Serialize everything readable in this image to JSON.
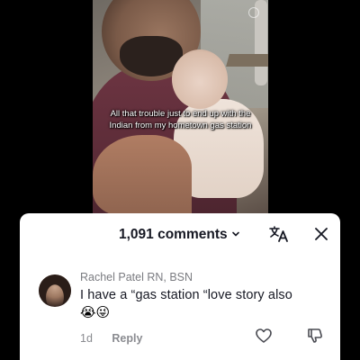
{
  "video": {
    "caption": "All that trouble just to end up with the Indian from my hometown gas station"
  },
  "comments_sheet": {
    "count_label": "1,091 comments",
    "chevron": "˅",
    "icons": {
      "translate": "translate-icon",
      "close": "close-icon"
    }
  },
  "comment": {
    "username": "Rachel Patel RN, BSN",
    "text": "I have a “gas station “love story also",
    "emojis": "😭😜",
    "time": "1d",
    "reply_label": "Reply",
    "icons": {
      "like": "heart-outline-icon",
      "dislike": "thumbs-down-icon"
    }
  }
}
